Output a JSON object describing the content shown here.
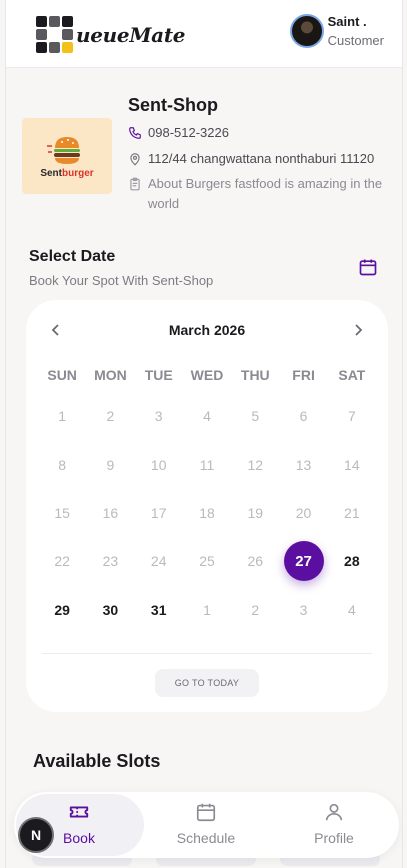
{
  "header": {
    "logo_text": "ueueMate",
    "user_name": "Saint .",
    "user_role": "Customer"
  },
  "shop": {
    "logo_text_a": "Sent",
    "logo_text_b": "burger",
    "name": "Sent-Shop",
    "phone": "098-512-3226",
    "address": "112/44 changwattana nonthaburi 11120",
    "description": "About Burgers fastfood is amazing in the world"
  },
  "select_date": {
    "title": "Select Date",
    "subtitle": "Book Your Spot With Sent-Shop"
  },
  "calendar": {
    "month_label": "March 2026",
    "weekdays": [
      "SUN",
      "MON",
      "TUE",
      "WED",
      "THU",
      "FRI",
      "SAT"
    ],
    "days": [
      {
        "d": "1",
        "s": "disabled"
      },
      {
        "d": "2",
        "s": "disabled"
      },
      {
        "d": "3",
        "s": "disabled"
      },
      {
        "d": "4",
        "s": "disabled"
      },
      {
        "d": "5",
        "s": "disabled"
      },
      {
        "d": "6",
        "s": "disabled"
      },
      {
        "d": "7",
        "s": "disabled"
      },
      {
        "d": "8",
        "s": "disabled"
      },
      {
        "d": "9",
        "s": "disabled"
      },
      {
        "d": "10",
        "s": "disabled"
      },
      {
        "d": "11",
        "s": "disabled"
      },
      {
        "d": "12",
        "s": "disabled"
      },
      {
        "d": "13",
        "s": "disabled"
      },
      {
        "d": "14",
        "s": "disabled"
      },
      {
        "d": "15",
        "s": "disabled"
      },
      {
        "d": "16",
        "s": "disabled"
      },
      {
        "d": "17",
        "s": "disabled"
      },
      {
        "d": "18",
        "s": "disabled"
      },
      {
        "d": "19",
        "s": "disabled"
      },
      {
        "d": "20",
        "s": "disabled"
      },
      {
        "d": "21",
        "s": "disabled"
      },
      {
        "d": "22",
        "s": "disabled"
      },
      {
        "d": "23",
        "s": "disabled"
      },
      {
        "d": "24",
        "s": "disabled"
      },
      {
        "d": "25",
        "s": "disabled"
      },
      {
        "d": "26",
        "s": "disabled"
      },
      {
        "d": "27",
        "s": "selected"
      },
      {
        "d": "28",
        "s": "active"
      },
      {
        "d": "29",
        "s": "active"
      },
      {
        "d": "30",
        "s": "active"
      },
      {
        "d": "31",
        "s": "active"
      },
      {
        "d": "1",
        "s": "disabled"
      },
      {
        "d": "2",
        "s": "disabled"
      },
      {
        "d": "3",
        "s": "disabled"
      },
      {
        "d": "4",
        "s": "disabled"
      }
    ],
    "today_button": "GO TO TODAY"
  },
  "slots": {
    "title": "Available Slots"
  },
  "bottom_nav": {
    "items": [
      {
        "label": "Book",
        "icon": "ticket-icon",
        "active": true
      },
      {
        "label": "Schedule",
        "icon": "calendar-icon",
        "active": false
      },
      {
        "label": "Profile",
        "icon": "user-icon",
        "active": false
      }
    ],
    "fab_letter": "N"
  },
  "colors": {
    "accent": "#5b0fa0",
    "logo_yellow": "#f2c21b",
    "logo_dark": "#1b1b1f"
  }
}
